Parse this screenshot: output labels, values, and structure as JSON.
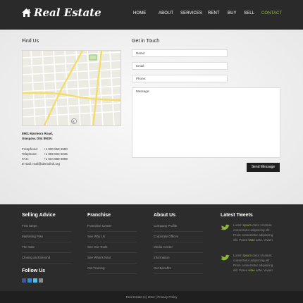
{
  "header": {
    "logo_text": "Real Estate",
    "nav": [
      "HOME",
      "ABOUT",
      "SERVICES",
      "RENT",
      "BUY",
      "SELL",
      "CONTACT"
    ],
    "active": "CONTACT"
  },
  "find_us": {
    "title": "Find Us",
    "address_line1": "8901 Marmora Road,",
    "address_line2": "Glasgow, D04 89GR.",
    "contacts": [
      {
        "label": "Freephone:",
        "value": "+1 800 559 6580"
      },
      {
        "label": "Telephone:",
        "value": "+1 959 603 6035"
      },
      {
        "label": "FAX:",
        "value": "+1 504 889 9898"
      }
    ],
    "email_label": "E-mail:",
    "email": "mail@demolink.org"
  },
  "contact_form": {
    "title": "Get in Touch",
    "name_placeholder": "Name:",
    "email_placeholder": "Email:",
    "phone_placeholder": "Phone:",
    "message_placeholder": "Message:",
    "send_label": "Send Message"
  },
  "footer": {
    "selling_advice": {
      "title": "Selling Advice",
      "links": [
        "First Steps",
        "Marketing Plan",
        "The Sale",
        "Closing and Beyond"
      ]
    },
    "franchise": {
      "title": "Franchise",
      "links": [
        "Franchise Center",
        "See Why Us",
        "See Our Tools",
        "See What's Next",
        "Get Training"
      ]
    },
    "about_us": {
      "title": "About Us",
      "links": [
        "Company Profile",
        "Corporate Offices",
        "Media Center",
        "Information",
        "Get Benefits"
      ]
    },
    "follow_us": "Follow Us",
    "tweets_title": "Latest Tweets",
    "tweets": [
      {
        "pre": "Lorem ",
        "hl": "ipsum",
        "mid": " dolor sit amet, consectetur adipiscing elit. Proin consectetur adipiscing elit. Praes ",
        "hl2": "vitae",
        "post": " ante. Vivam"
      },
      {
        "pre": "Lorem ",
        "hl": "ipsum",
        "mid": " dolor sit amet, consectetur adipiscing elit. Proin consectetur adipiscing elit. Praes ",
        "hl2": "vitae",
        "post": " ante. Vivam"
      }
    ],
    "copyright": "Real Estate (c) 2012 | Privacy Policy"
  },
  "colors": {
    "accent": "#9bc43b",
    "dark": "#2a2a2a"
  }
}
